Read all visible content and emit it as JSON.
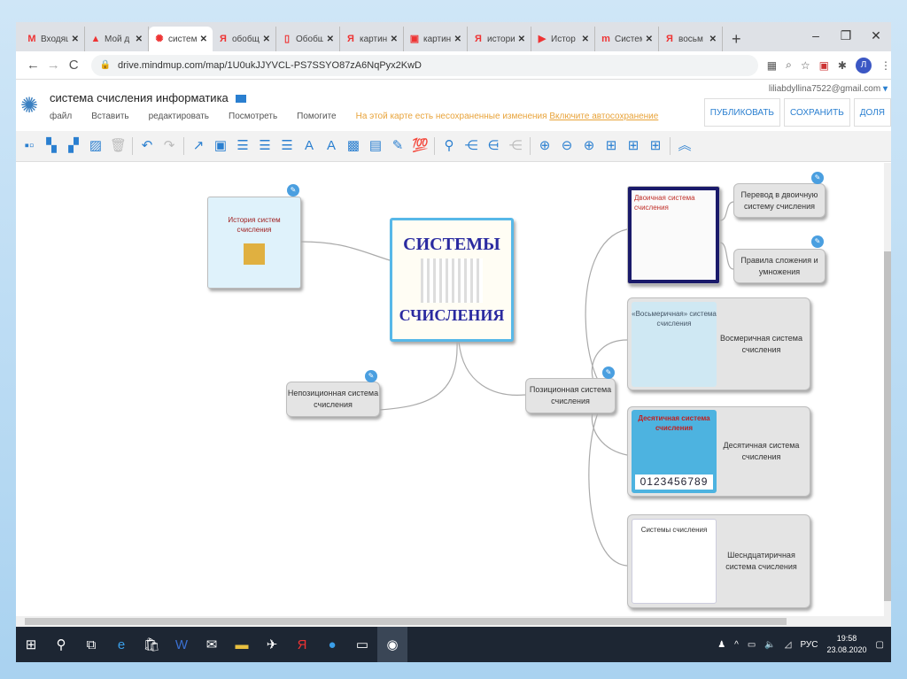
{
  "browser": {
    "tabs": [
      {
        "icon": "M",
        "label": "Входящ",
        "active": false
      },
      {
        "icon": "▲",
        "label": "Мой д",
        "active": false
      },
      {
        "icon": "✺",
        "label": "систем",
        "active": true
      },
      {
        "icon": "Я",
        "label": "обобщ",
        "active": false
      },
      {
        "icon": "▯",
        "label": "Обобщ",
        "active": false
      },
      {
        "icon": "Я",
        "label": "картин",
        "active": false
      },
      {
        "icon": "▣",
        "label": "картин",
        "active": false
      },
      {
        "icon": "Я",
        "label": "истори",
        "active": false
      },
      {
        "icon": "▶",
        "label": "Истор",
        "active": false
      },
      {
        "icon": "m",
        "label": "Систем",
        "active": false
      },
      {
        "icon": "Я",
        "label": "восьм",
        "active": false
      }
    ],
    "url": "drive.mindmup.com/map/1U0ukJJYVCL-PS7SSYO87zA6NqPyx2KwD",
    "profile_initial": "Л"
  },
  "app": {
    "title": "система счисления информатика",
    "menu": [
      "файл",
      "Вставить",
      "редактировать",
      "Посмотреть",
      "Помогите"
    ],
    "warning": "На этой карте есть несохраненные изменения",
    "autosave_link": "Включите автосохранение",
    "account": "liliabdyllina7522@gmail.com",
    "buttons": [
      "ПУБЛИКОВАТЬ",
      "СОХРАНИТЬ",
      "ДОЛЯ"
    ]
  },
  "map": {
    "center": {
      "line1": "СИСТЕМЫ",
      "line2": "СЧИСЛЕНИЯ"
    },
    "history": "История систем счисления",
    "nonpositional": "Непозиционная система счисления",
    "positional": "Позиционная система счисления",
    "binary_img": "Двоичная система счисления",
    "translate": "Перевод в двоичную систему счисления",
    "rules": "Правила сложения и умножения",
    "octal": "Восмеричная система счисления",
    "octal_img": "«Восьмеричная» система счисления",
    "decimal": "Десятичная система счисления",
    "decimal_img": "Десятичная система счисления",
    "decimal_digits": "0123456789",
    "hex": "Шесндцатиричная система счисления",
    "hex_img": "Системы счисления"
  },
  "taskbar": {
    "lang": "РУС",
    "time": "19:58",
    "date": "23.08.2020"
  }
}
